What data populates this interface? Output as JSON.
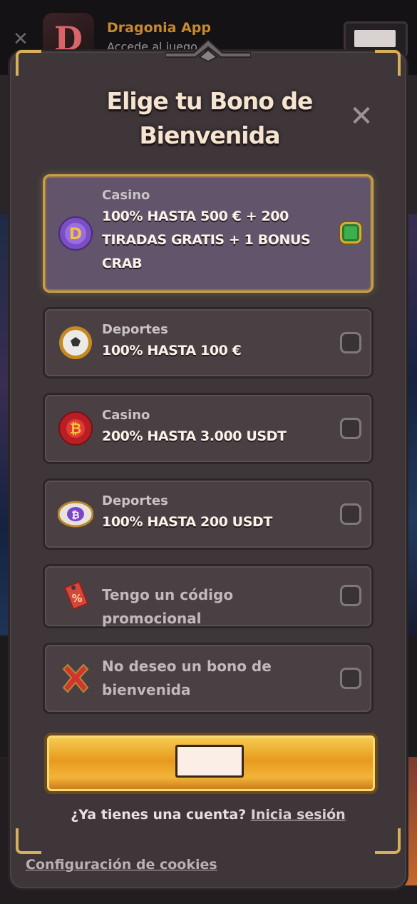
{
  "banner": {
    "app_title": "Dragonia App",
    "app_subtitle": "Accede al juego"
  },
  "modal": {
    "title": "Elige tu Bono de Bienvenida",
    "close_symbol": "✕",
    "options": [
      {
        "category": "Casino",
        "offer": "100% HASTA 500 € + 200 TIRADAS GRATIS + 1 BONUS CRAB",
        "icon": "dragonia-coin-icon",
        "selected": true
      },
      {
        "category": "Deportes",
        "offer": "100% HASTA 100 €",
        "icon": "soccer-ball-icon",
        "selected": false
      },
      {
        "category": "Casino",
        "offer": "200% HASTA 3.000 USDT",
        "icon": "bitcoin-chip-icon",
        "selected": false
      },
      {
        "category": "Deportes",
        "offer": "100% HASTA 200 USDT",
        "icon": "bitcoin-football-icon",
        "selected": false
      },
      {
        "label": "Tengo un código promocional",
        "icon": "promo-tag-icon",
        "selected": false
      },
      {
        "label": "No deseo un bono de bienvenida",
        "icon": "red-x-icon",
        "selected": false
      }
    ],
    "login_prompt": "¿Ya tienes una cuenta?",
    "login_link": "Inicia sesión",
    "cookies_link": "Configuración de cookies"
  },
  "colors": {
    "accent_gold": "#d6b159",
    "selected_check": "#3cb04a",
    "modal_bg": "#3e3639"
  }
}
